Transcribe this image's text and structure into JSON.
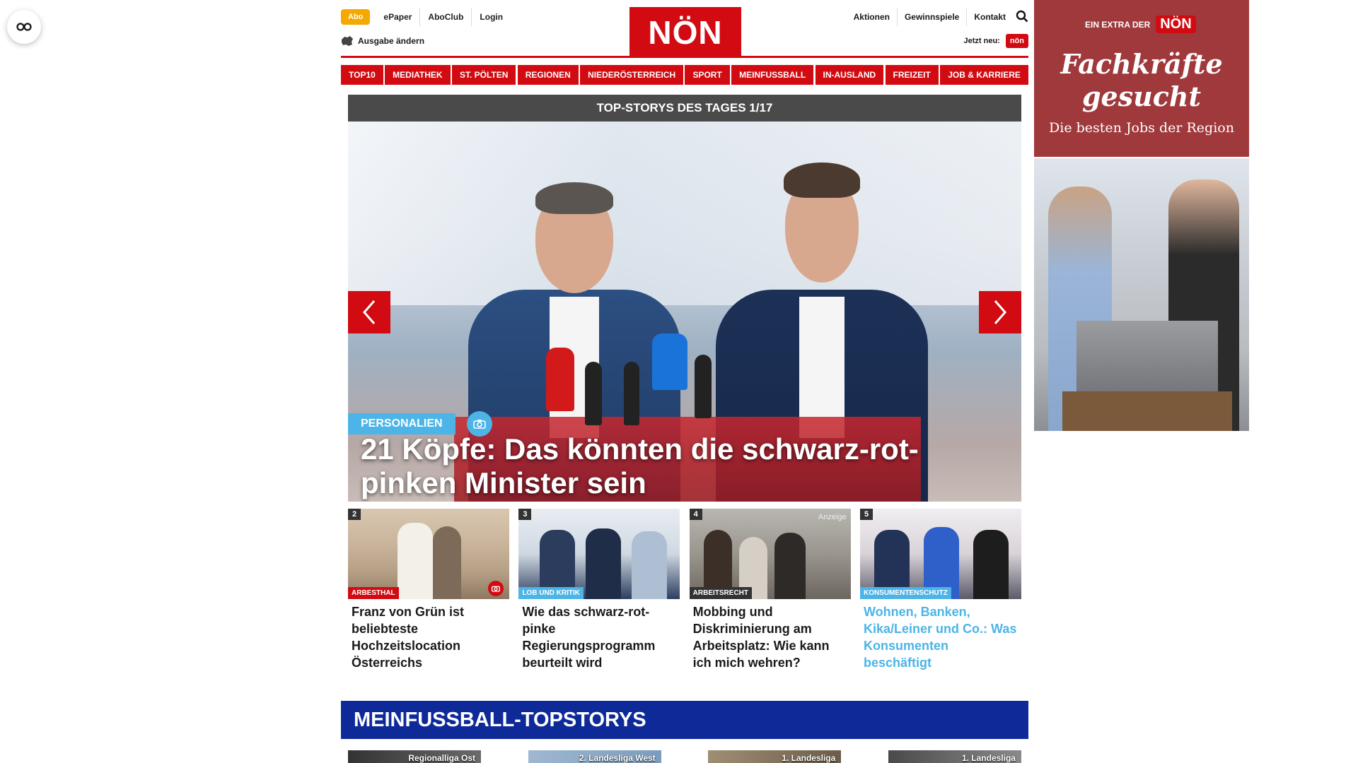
{
  "header": {
    "abo": "Abo",
    "left_links": [
      "ePaper",
      "AboClub",
      "Login"
    ],
    "ausgabe": "Ausgabe ändern",
    "logo": "NÖN",
    "right_links": [
      "Aktionen",
      "Gewinnspiele",
      "Kontakt"
    ],
    "jetzt_neu": "Jetzt neu:",
    "jetzt_neu_badge": "nön"
  },
  "nav": [
    "TOP10",
    "MEDIATHEK",
    "ST. PÖLTEN",
    "REGIONEN",
    "NIEDERÖSTERREICH",
    "SPORT",
    "MEINFUSSBALL",
    "IN-AUSLAND",
    "FREIZEIT",
    "JOB & KARRIERE"
  ],
  "slider": {
    "heading": "TOP-STORYS DES TAGES 1/17",
    "category": "PERSONALIEN",
    "title": "21 Köpfe: Das könnten die schwarz-rot-pinken Minister sein"
  },
  "teasers": [
    {
      "num": "2",
      "category": "ARBESTHAL",
      "title": "Franz von Grün ist beliebteste Hochzeitslocation Österreichs",
      "anzeige": ""
    },
    {
      "num": "3",
      "category": "LOB UND KRITIK",
      "title": "Wie das schwarz-rot-pinke Regierungsprogramm beurteilt wird",
      "anzeige": ""
    },
    {
      "num": "4",
      "category": "ARBEITSRECHT",
      "title": "Mobbing und Diskriminierung am Arbeitsplatz: Wie kann ich mich wehren?",
      "anzeige": "Anzeige"
    },
    {
      "num": "5",
      "category": "KONSUMENTENSCHUTZ",
      "title": "Wohnen, Banken, Kika/Leiner und Co.: Was Konsumenten beschäftigt",
      "anzeige": ""
    }
  ],
  "fussball": {
    "heading": "MEINFUSSBALL-TOPSTORYS",
    "cards": [
      "Regionalliga Ost",
      "2. Landesliga West",
      "1. Landesliga",
      "1. Landesliga"
    ]
  },
  "ad": {
    "extra_prefix": "EIN EXTRA DER",
    "logo": "NÖN",
    "title_line1": "Fachkräfte",
    "title_line2": "gesucht",
    "subtitle": "Die besten Jobs der Region"
  },
  "colors": {
    "brand_red": "#d20a11",
    "accent_blue": "#4cb4e7",
    "fussball_blue": "#0e2a99",
    "abo_orange": "#f5a800"
  }
}
